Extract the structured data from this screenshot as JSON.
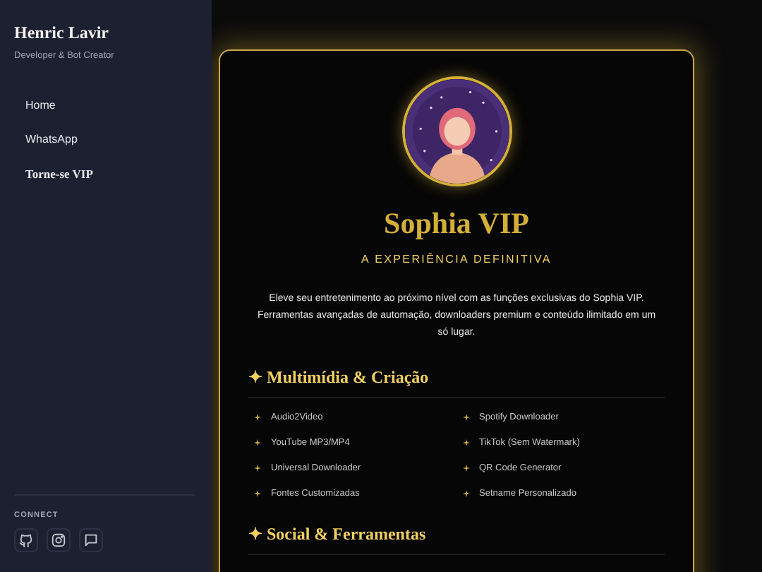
{
  "sidebar": {
    "name": "Henric Lavir",
    "tagline": "Developer & Bot Creator",
    "items": [
      {
        "label": "Home",
        "kind": "plain"
      },
      {
        "label": "WhatsApp",
        "kind": "plain"
      },
      {
        "label": "Torne-se VIP",
        "kind": "vip"
      }
    ],
    "connect": {
      "label": "CONNECT",
      "links": [
        {
          "kind": "github"
        },
        {
          "kind": "instagram"
        },
        {
          "kind": "chat"
        }
      ]
    }
  },
  "card": {
    "title": "Sophia VIP",
    "subtitle": "A EXPERIÊNCIA DEFINITIVA",
    "description": "Eleve seu entretenimento ao próximo nível com as funções exclusivas do Sophia VIP. Ferramentas avançadas de automação, downloaders premium e conteúdo ilimitado em um só lugar.",
    "sections": [
      {
        "heading": "✦ Multimídia & Criação",
        "items": [
          "Audio2Video",
          "Spotify Downloader",
          "YouTube MP3/MP4",
          "TikTok (Sem Watermark)",
          "Universal Downloader",
          "QR Code Generator",
          "Fontes Customizadas",
          "Setname Personalizado"
        ]
      },
      {
        "heading": "✦ Social & Ferramentas"
      }
    ]
  }
}
